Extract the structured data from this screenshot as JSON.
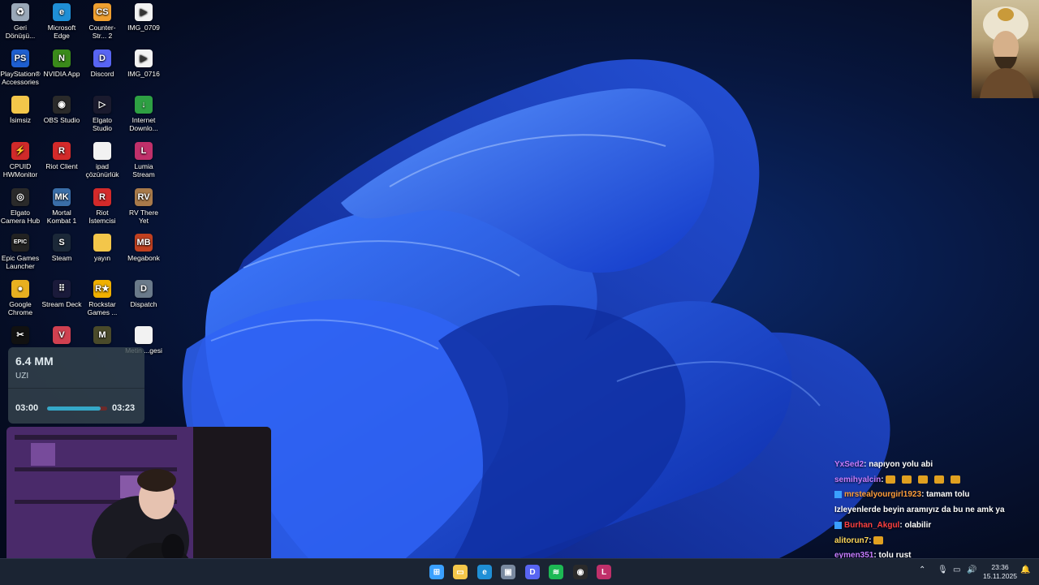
{
  "desktop": {
    "icons": [
      {
        "label": "Geri Dönüşü...",
        "icon": "recycle-bin-icon",
        "color": "#9aa8b8",
        "glyph": "♻"
      },
      {
        "label": "Microsoft Edge",
        "icon": "edge-icon",
        "color": "#1f8fd6",
        "glyph": "e"
      },
      {
        "label": "Counter-Str... 2",
        "icon": "cs2-icon",
        "color": "#f0a030",
        "glyph": "CS"
      },
      {
        "label": "IMG_0709",
        "icon": "video-file-icon",
        "color": "#f2f2f2",
        "glyph": "▶"
      },
      {
        "label": "PlayStation® Accessories",
        "icon": "playstation-icon",
        "color": "#1e5fd0",
        "glyph": "PS"
      },
      {
        "label": "NVIDIA App",
        "icon": "nvidia-icon",
        "color": "#3a8a1a",
        "glyph": "N"
      },
      {
        "label": "Discord",
        "icon": "discord-icon",
        "color": "#5865f2",
        "glyph": "D"
      },
      {
        "label": "IMG_0716",
        "icon": "video-file-icon",
        "color": "#f2f2f2",
        "glyph": "▶"
      },
      {
        "label": "İsimsiz",
        "icon": "folder-icon",
        "color": "#f3c64a",
        "glyph": ""
      },
      {
        "label": "OBS Studio",
        "icon": "obs-icon",
        "color": "#2a2a2a",
        "glyph": "◉"
      },
      {
        "label": "Elgato Studio",
        "icon": "elgato-studio-icon",
        "color": "#1a1a2e",
        "glyph": "▷"
      },
      {
        "label": "Internet Downlo...",
        "icon": "idm-icon",
        "color": "#2ea043",
        "glyph": "↓"
      },
      {
        "label": "CPUID HWMonitor",
        "icon": "hwmonitor-icon",
        "color": "#d02a2a",
        "glyph": "⚡"
      },
      {
        "label": "Riot Client",
        "icon": "riot-icon",
        "color": "#d32a2a",
        "glyph": "R"
      },
      {
        "label": "ipad çözünürlük",
        "icon": "text-file-icon",
        "color": "#f2f2f2",
        "glyph": ""
      },
      {
        "label": "Lumia Stream",
        "icon": "lumia-icon",
        "color": "#c0306a",
        "glyph": "L"
      },
      {
        "label": "Elgato Camera Hub",
        "icon": "camera-hub-icon",
        "color": "#2a2a2a",
        "glyph": "◎"
      },
      {
        "label": "Mortal Kombat 1",
        "icon": "mk1-icon",
        "color": "#3a6ea8",
        "glyph": "MK"
      },
      {
        "label": "Riot İstemcisi",
        "icon": "riot-icon",
        "color": "#d32a2a",
        "glyph": "R"
      },
      {
        "label": "RV There Yet",
        "icon": "rv-game-icon",
        "color": "#a87a4a",
        "glyph": "RV"
      },
      {
        "label": "Epic Games Launcher",
        "icon": "epic-icon",
        "color": "#222222",
        "glyph": "EPIC"
      },
      {
        "label": "Steam",
        "icon": "steam-icon",
        "color": "#1b2838",
        "glyph": "S"
      },
      {
        "label": "yayın",
        "icon": "folder-icon",
        "color": "#f3c64a",
        "glyph": ""
      },
      {
        "label": "Megabonk",
        "icon": "megabonk-icon",
        "color": "#c04020",
        "glyph": "MB"
      },
      {
        "label": "Google Chrome",
        "icon": "chrome-icon",
        "color": "#e8b020",
        "glyph": "●"
      },
      {
        "label": "Stream Deck",
        "icon": "stream-deck-icon",
        "color": "#1a1a3a",
        "glyph": "⠿"
      },
      {
        "label": "Rockstar Games ...",
        "icon": "rockstar-icon",
        "color": "#f0b000",
        "glyph": "R★"
      },
      {
        "label": "Dispatch",
        "icon": "dispatch-icon",
        "color": "#6a7a8a",
        "glyph": "D"
      },
      {
        "label": "",
        "icon": "capcut-icon",
        "color": "#111111",
        "glyph": "✂"
      },
      {
        "label": "",
        "icon": "valorant-icon",
        "color": "#d04050",
        "glyph": "V"
      },
      {
        "label": "",
        "icon": "game-icon",
        "color": "#4a4a2a",
        "glyph": "M"
      },
      {
        "label": "Metin ...gesi",
        "icon": "text-file-icon",
        "color": "#f2f2f2",
        "glyph": ""
      }
    ]
  },
  "music_widget": {
    "title": "6.4 MM",
    "artist": "UZI",
    "elapsed": "03:00",
    "duration": "03:23",
    "progress": 0.89
  },
  "chat": [
    {
      "user": "YxSed2",
      "color": "#c77dff",
      "message": ": napıyon yolu abi"
    },
    {
      "user": "semihyalcin",
      "color": "#c77dff",
      "message": ":",
      "emotes": 5
    },
    {
      "user": "mrstealyourgirl1923",
      "color": "#ff9d3a",
      "message": ": tamam tolu",
      "badges": true
    },
    {
      "user": "",
      "color": "#ffffff",
      "message": "Izleyenlerde beyin aramıyız da bu ne amk ya"
    },
    {
      "user": "Burhan_Akgul",
      "color": "#ff4040",
      "message": ": olabilir",
      "badges": true
    },
    {
      "user": "alitorun7",
      "color": "#ffd85a",
      "message": ":",
      "emotes": 1
    },
    {
      "user": "eymen351",
      "color": "#c77dff",
      "message": ": tolu rust"
    }
  ],
  "taskbar": {
    "apps": [
      {
        "icon": "start-icon",
        "color": "#3aa0ff",
        "glyph": "⊞"
      },
      {
        "icon": "file-explorer-icon",
        "color": "#f3c64a",
        "glyph": "▭"
      },
      {
        "icon": "edge-icon",
        "color": "#1f8fd6",
        "glyph": "e"
      },
      {
        "icon": "store-icon",
        "color": "#7a8aa0",
        "glyph": "▣"
      },
      {
        "icon": "discord-icon",
        "color": "#5865f2",
        "glyph": "D"
      },
      {
        "icon": "spotify-icon",
        "color": "#1db954",
        "glyph": "≋"
      },
      {
        "icon": "obs-icon",
        "color": "#2a2a2a",
        "glyph": "◉"
      },
      {
        "icon": "lumia-icon",
        "color": "#c0306a",
        "glyph": "L"
      }
    ],
    "time": "23:36",
    "date": "15.11.2025"
  }
}
